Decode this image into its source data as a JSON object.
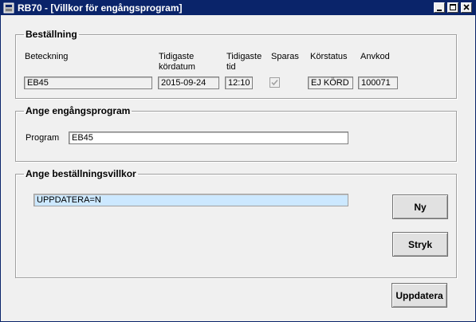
{
  "window": {
    "title": "RB70 - [Villkor för engångsprogram]"
  },
  "bestallning": {
    "legend": "Beställning",
    "labels": {
      "beteckning": "Beteckning",
      "kordatum_line1": "Tidigaste",
      "kordatum_line2": "kördatum",
      "tid_line1": "Tidigaste",
      "tid_line2": "tid",
      "sparas": "Sparas",
      "korstatus": "Körstatus",
      "anvkod": "Anvkod"
    },
    "values": {
      "beteckning": "EB45",
      "kordatum": "2015-09-24",
      "tid": "12:10",
      "sparas_checked": true,
      "korstatus": "EJ KÖRD",
      "anvkod": "100071"
    }
  },
  "engangsprogram": {
    "legend": "Ange engångsprogram",
    "program_label": "Program",
    "program_value": "EB45"
  },
  "villkor": {
    "legend": "Ange beställningsvillkor",
    "items": [
      "UPPDATERA=N"
    ],
    "ny_label": "Ny",
    "stryk_label": "Stryk"
  },
  "footer": {
    "uppdatera_label": "Uppdatera"
  }
}
